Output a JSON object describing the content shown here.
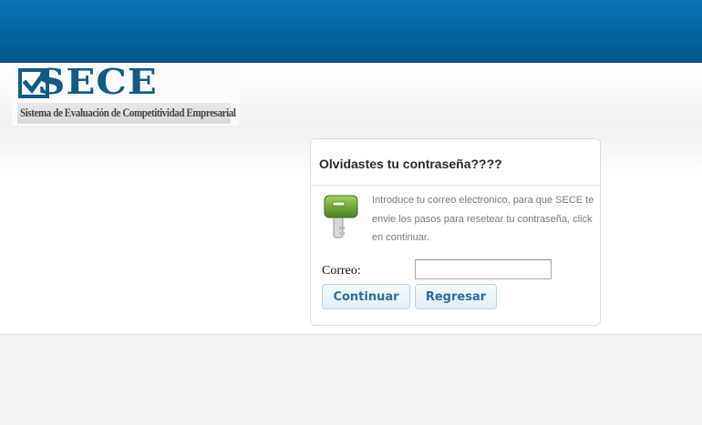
{
  "logo": {
    "title": "SECE",
    "subtitle": "Sistema de Evaluación de Competitividad Empresarial",
    "icon": "checkbox-icon"
  },
  "panel": {
    "title": "Olvidastes tu contraseña????",
    "description": "Introduce tu correo electronico, para que SECE te envie los pasos para resetear tu contraseña, click en continuar.",
    "icon": "key-icon"
  },
  "form": {
    "email_label": "Correo:",
    "email_value": "",
    "continue_label": "Continuar",
    "back_label": "Regresar"
  },
  "colors": {
    "top_bar": "#04649f",
    "brand": "#145b86",
    "button_text": "#2e6e9e",
    "key_green": "#6fa43a"
  }
}
